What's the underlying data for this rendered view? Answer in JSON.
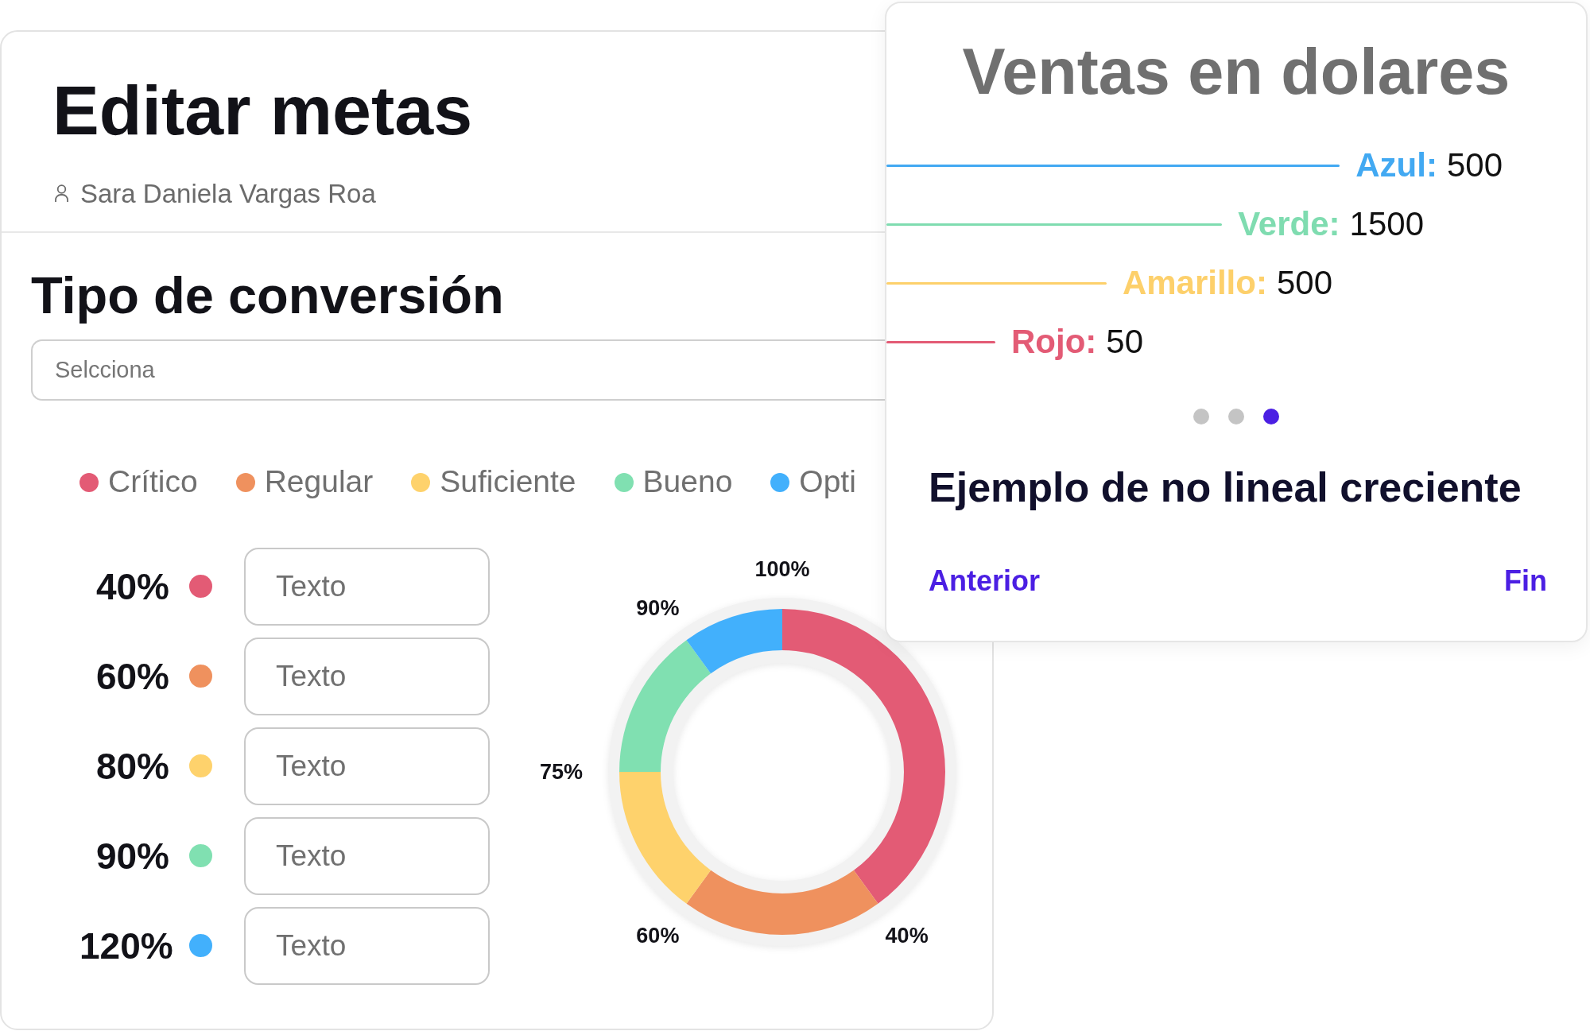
{
  "goal_editor": {
    "title": "Editar metas",
    "owner": "Sara Daniela Vargas Roa",
    "section_title": "Tipo de conversión",
    "conversion_select": {
      "placeholder": "Selcciona"
    },
    "legend": [
      {
        "label": "Crítico",
        "color": "#e35b75"
      },
      {
        "label": "Regular",
        "color": "#ef915e"
      },
      {
        "label": "Suficiente",
        "color": "#fed26c"
      },
      {
        "label": "Bueno",
        "color": "#80e0b1"
      },
      {
        "label": "Opti",
        "color": "#42b0fc"
      }
    ],
    "thresholds": [
      {
        "percent": "40%",
        "color": "#e35b75",
        "placeholder": "Texto"
      },
      {
        "percent": "60%",
        "color": "#ef915e",
        "placeholder": "Texto"
      },
      {
        "percent": "80%",
        "color": "#fed26c",
        "placeholder": "Texto"
      },
      {
        "percent": "90%",
        "color": "#80e0b1",
        "placeholder": "Texto"
      },
      {
        "percent": "120%",
        "color": "#42b0fc",
        "placeholder": "Texto"
      }
    ],
    "chart_data": {
      "type": "donut",
      "categories": [
        "40%",
        "60%",
        "75%",
        "90%",
        "100%"
      ],
      "values": [
        40,
        20,
        15,
        15,
        10
      ]
    }
  },
  "sales_card": {
    "title": "Ventas en dolares",
    "series": [
      {
        "name": "Azul:",
        "value": "500",
        "color": "#42a9f2"
      },
      {
        "name": "Verde:",
        "value": "1500",
        "color": "#7fdcb0"
      },
      {
        "name": "Amarillo:",
        "value": "500",
        "color": "#fdd06b"
      },
      {
        "name": "Rojo:",
        "value": "50",
        "color": "#e35b75"
      }
    ],
    "pagination": [
      {
        "selected": false
      },
      {
        "selected": false
      },
      {
        "selected": true
      }
    ],
    "caption": "Ejemplo de no lineal creciente",
    "previous": "Anterior",
    "next": "Fin"
  }
}
